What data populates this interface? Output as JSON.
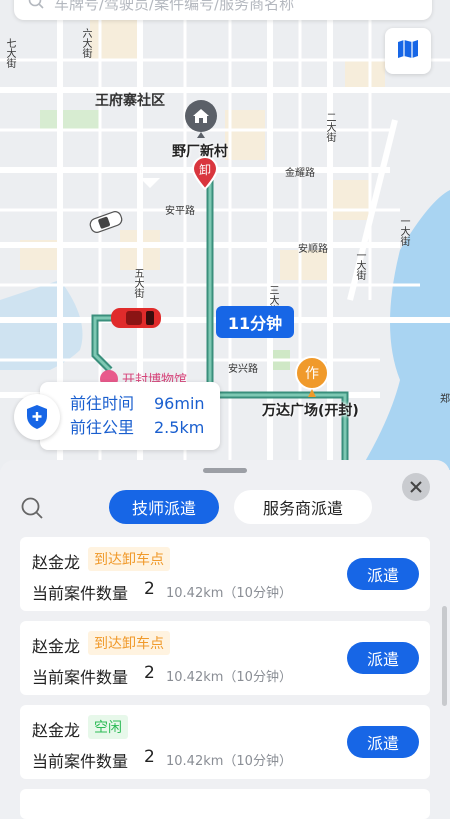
{
  "search": {
    "placeholder": "车牌号/驾驶员/案件编号/服务商名称"
  },
  "map": {
    "labels": {
      "area": "王府寨社区",
      "road_qida": "七大街",
      "road_liuda": "六大街",
      "road_wuda": "五大街",
      "road_erda": "二大街",
      "road_yida": "一大街",
      "road_sanda": "三大街",
      "road_yida_top": "一大街",
      "road_jinyao": "金耀路",
      "road_anping": "安平路",
      "road_anshun": "安顺路",
      "road_anxing": "安兴路",
      "road_edge": "郑"
    },
    "poi_start": "野厂新村",
    "unload_marker": "卸",
    "work_marker": "作",
    "poi_end": "万达广场(开封)",
    "museum": "开封博物馆",
    "time_badge": "11分钟"
  },
  "info": {
    "time_label": "前往时间",
    "time_value": "96min",
    "dist_label": "前往公里",
    "dist_value": "2.5km"
  },
  "sheet": {
    "tabs": [
      "技师派遣",
      "服务商派遣"
    ],
    "cards": [
      {
        "name": "赵金龙",
        "status": "到达卸车点",
        "count_label": "当前案件数量",
        "count": "2",
        "distance": "10.42km（10分钟）",
        "action": "派遣"
      },
      {
        "name": "赵金龙",
        "status": "到达卸车点",
        "count_label": "当前案件数量",
        "count": "2",
        "distance": "10.42km（10分钟）",
        "action": "派遣"
      },
      {
        "name": "赵金龙",
        "status": "空闲",
        "count_label": "当前案件数量",
        "count": "2",
        "distance": "10.42km（10分钟）",
        "action": "派遣"
      }
    ]
  },
  "colors": {
    "accent": "#1766e6",
    "route": "#3a8f7c",
    "orange": "#f09a2b",
    "green": "#2dbb57",
    "red_marker": "#d9363e"
  },
  "icons": [
    "search-icon",
    "map-layers-icon",
    "house-icon",
    "shield-plus-icon",
    "close-icon",
    "car-icon"
  ]
}
